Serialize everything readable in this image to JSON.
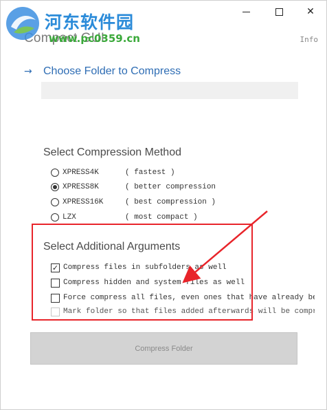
{
  "window": {
    "title": "Compact GUI",
    "info_link": "Info",
    "controls": {
      "minimize": "—",
      "maximize": "□",
      "close": "✕"
    }
  },
  "watermark": {
    "site_name": "河东软件园",
    "url": "www.pc0359.cn",
    "logo_icon": "swirl-logo-icon"
  },
  "choose_folder": {
    "arrow_icon": "→",
    "label": "Choose Folder to Compress",
    "path_value": ""
  },
  "method_section": {
    "title": "Select Compression Method",
    "options": [
      {
        "name": "XPRESS4K",
        "desc": "( fastest )",
        "selected": false
      },
      {
        "name": "XPRESS8K",
        "desc": "( better compression",
        "selected": true
      },
      {
        "name": "XPRESS16K",
        "desc": "( best compression )",
        "selected": false
      },
      {
        "name": "LZX",
        "desc": "( most compact )",
        "selected": false
      }
    ]
  },
  "args_section": {
    "title": "Select Additional Arguments",
    "options": [
      {
        "label": "Compress files in subfolders as well",
        "checked": true,
        "enabled": true
      },
      {
        "label": "Compress hidden and system files as well",
        "checked": false,
        "enabled": true
      },
      {
        "label": "Force compress all files, even ones that have already been compressed",
        "checked": false,
        "enabled": true
      },
      {
        "label": "Mark folder so that files added afterwards will be compressed",
        "checked": false,
        "enabled": false
      }
    ]
  },
  "compress_button": {
    "label": "Compress Folder",
    "enabled": false
  },
  "colors": {
    "accent": "#2e6db4",
    "annotation": "#e8242a",
    "button_disabled": "#d3d3d3"
  }
}
